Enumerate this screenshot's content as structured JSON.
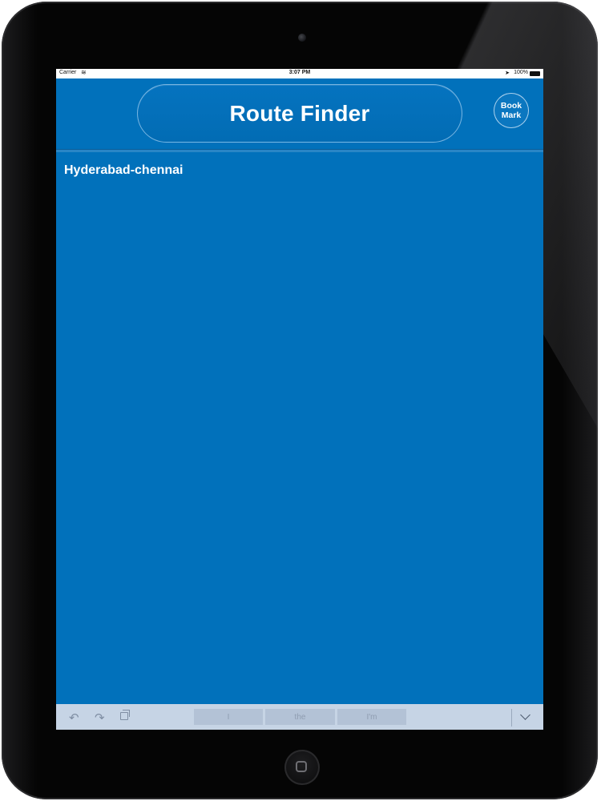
{
  "status_bar": {
    "carrier": "Carrier",
    "time": "3:07 PM",
    "battery": "100%"
  },
  "header": {
    "title": "Route Finder",
    "bookmark_line1": "Book",
    "bookmark_line2": "Mark"
  },
  "content": {
    "route": "Hyderabad-chennai"
  },
  "keyboard_bar": {
    "suggestions": [
      "I",
      "the",
      "I'm"
    ]
  },
  "colors": {
    "screen_background": "#0171bb",
    "keyboard_bar": "#c6d4e5"
  }
}
